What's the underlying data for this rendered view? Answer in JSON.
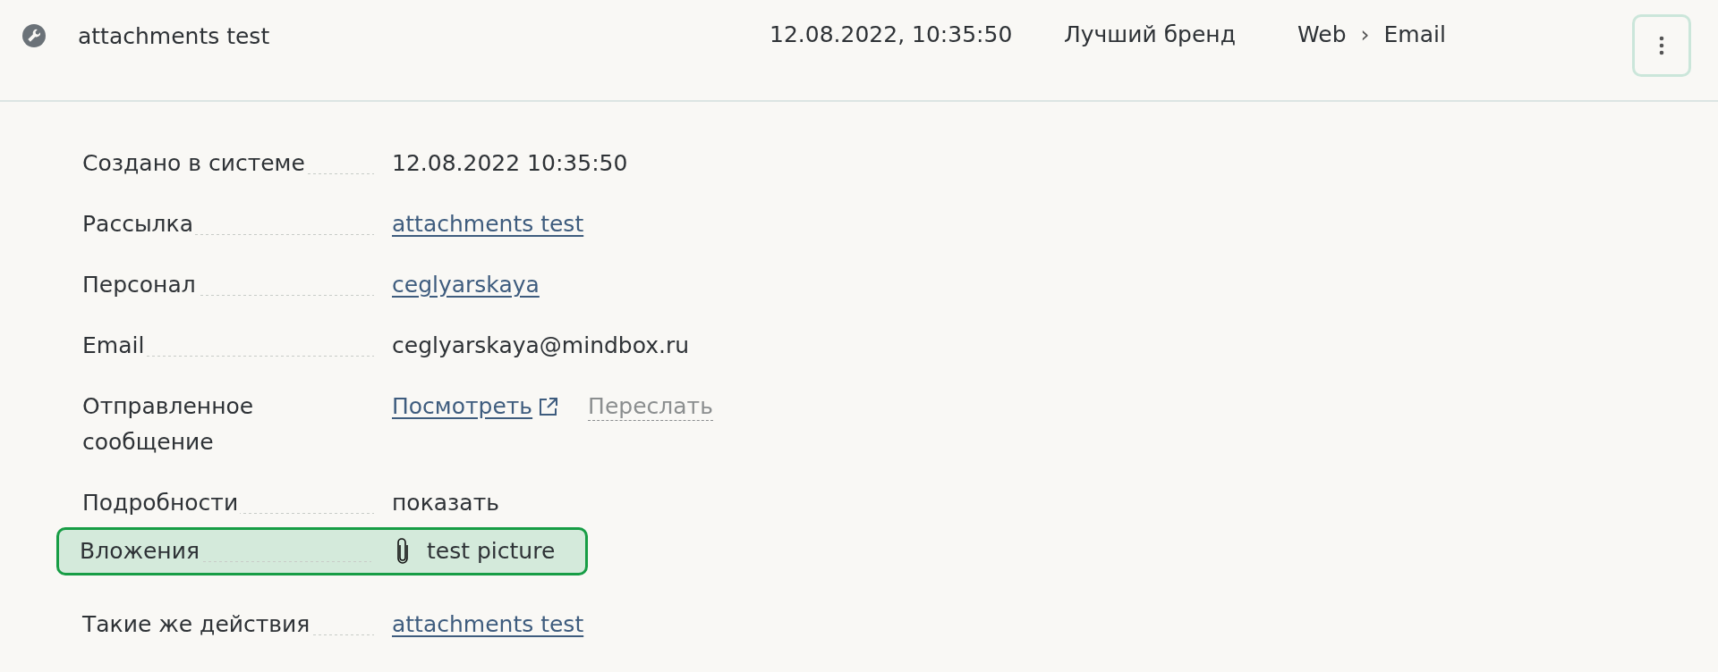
{
  "header": {
    "title": "attachments test",
    "datetime": "12.08.2022, 10:35:50",
    "brand": "Лучший бренд",
    "channel_path": [
      "Web",
      "Email"
    ],
    "separator": "›"
  },
  "details": [
    {
      "label": "Создано в системе",
      "highlighted": false,
      "values": [
        {
          "kind": "text",
          "text": "12.08.2022 10:35:50"
        }
      ]
    },
    {
      "label": "Рассылка",
      "highlighted": false,
      "values": [
        {
          "kind": "link",
          "text": "attachments test"
        }
      ]
    },
    {
      "label": "Персонал",
      "highlighted": false,
      "values": [
        {
          "kind": "link",
          "text": "ceglyarskaya"
        }
      ]
    },
    {
      "label": "Email",
      "highlighted": false,
      "values": [
        {
          "kind": "text",
          "text": "ceglyarskaya@mindbox.ru"
        }
      ]
    },
    {
      "label": "Отправленное сообщение",
      "highlighted": false,
      "values": [
        {
          "kind": "external-link",
          "text": "Посмотреть"
        },
        {
          "kind": "action",
          "text": "Переслать"
        }
      ]
    },
    {
      "label": "Подробности",
      "highlighted": false,
      "values": [
        {
          "kind": "text",
          "text": "показать"
        }
      ]
    },
    {
      "label": "Вложения",
      "highlighted": true,
      "values": [
        {
          "kind": "attachment",
          "text": "test picture"
        }
      ]
    },
    {
      "label": "Такие же действия",
      "highlighted": false,
      "values": [
        {
          "kind": "link",
          "text": "attachments test"
        }
      ]
    }
  ]
}
